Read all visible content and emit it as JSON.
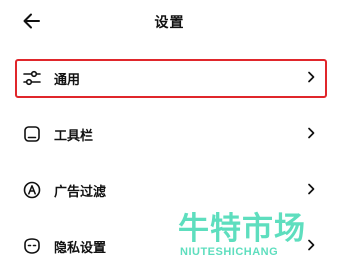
{
  "header": {
    "title": "设置",
    "back_icon": "arrow-left-icon"
  },
  "menu": {
    "items": [
      {
        "label": "通用",
        "icon": "sliders-icon",
        "selected": true
      },
      {
        "label": "工具栏",
        "icon": "toolbar-icon",
        "selected": false
      },
      {
        "label": "广告过滤",
        "icon": "ad-filter-icon",
        "selected": false
      },
      {
        "label": "隐私设置",
        "icon": "privacy-mask-icon",
        "selected": false
      }
    ],
    "chevron_icon": "chevron-right-icon"
  },
  "highlight_color": "#e0262b",
  "watermark": {
    "cn": "牛特市场",
    "en": "NIUTESHICHANG",
    "color": "#4ddbb8"
  }
}
